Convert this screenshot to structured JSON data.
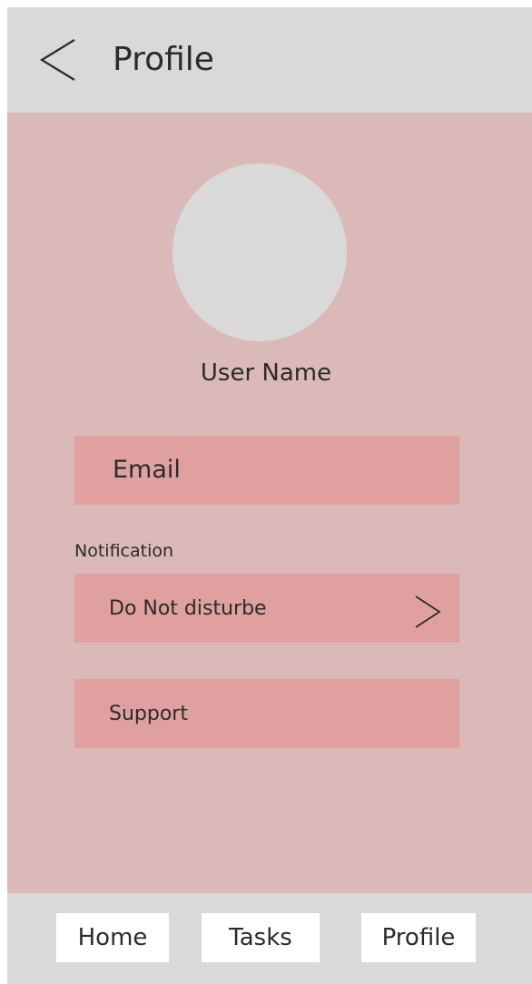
{
  "header": {
    "title": "Profile",
    "back_icon": "chevron-left-icon"
  },
  "profile": {
    "user_name": "User Name",
    "avatar": "avatar-placeholder"
  },
  "fields": {
    "email_label": "Email",
    "notification_section_label": "Notification",
    "do_not_disturb_label": "Do Not disturbe",
    "do_not_disturb_icon": "chevron-right-icon",
    "support_label": "Support"
  },
  "tabbar": {
    "items": [
      {
        "label": "Home"
      },
      {
        "label": "Tasks"
      },
      {
        "label": "Profile"
      }
    ]
  },
  "colors": {
    "header_bg": "#d9d9d9",
    "content_bg": "#dbb9b9",
    "field_bg": "#e0a0a0",
    "tab_bg": "#ffffff"
  }
}
